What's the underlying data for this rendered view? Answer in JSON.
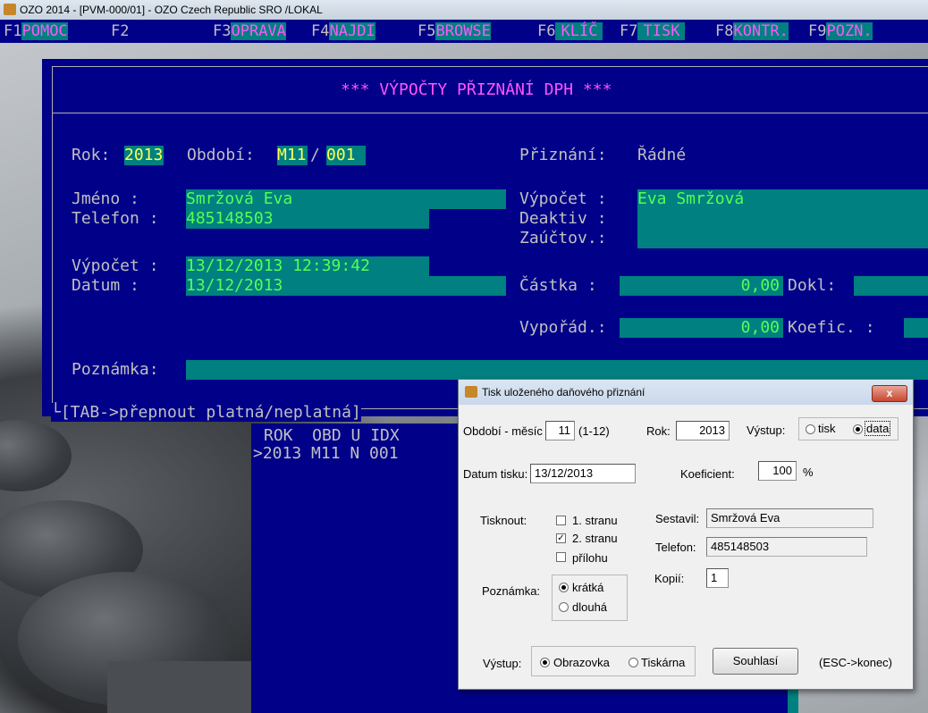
{
  "window": {
    "title": "OZO 2014 - [PVM-000/01] - OZO Czech Republic SRO  /LOKAL"
  },
  "menubar": [
    {
      "key": "F1",
      "label": "POMOC"
    },
    {
      "key": "F2",
      "label": ""
    },
    {
      "key": "F3",
      "label": "OPRAVA"
    },
    {
      "key": "F4",
      "label": "NAJDI"
    },
    {
      "key": "F5",
      "label": "BROWSE"
    },
    {
      "key": "F6",
      "label": "KLÍČ"
    },
    {
      "key": "F7",
      "label": "TISK"
    },
    {
      "key": "F8",
      "label": "KONTR."
    },
    {
      "key": "F9",
      "label": "POZN."
    }
  ],
  "main": {
    "heading": "*** VÝPOČTY PŘIZNÁNÍ DPH  ***",
    "rok_label": "Rok:",
    "rok": "2013",
    "obdobi_label": "Období:",
    "obdobi_m": "M11",
    "obdobi_sep": "/",
    "obdobi_n": "001",
    "priznani_label": "Přiznání:",
    "priznani": "Řádné",
    "jmeno_label": "Jméno   :",
    "jmeno": "Smržová Eva",
    "telefon_label": "Telefon :",
    "telefon": "485148503",
    "vypocet_label_r": "Výpočet :",
    "vypocet_r": "Eva Smržová",
    "deaktiv_label": "Deaktiv :",
    "zauctov_label": "Zaúčtov.:",
    "vypocet_label": "Výpočet :",
    "vypocet": "13/12/2013 12:39:42",
    "datum_label": "Datum   :",
    "datum": "13/12/2013",
    "castka_label": "Částka   :",
    "castka": "0,00",
    "dokl_label": "Dokl:",
    "vyporad_label": "Vypořád.:",
    "vyporad": "0,00",
    "koefic_label": "Koefic. :",
    "poznamka_label": "Poznámka:",
    "footer": "└[TAB->přepnout platná/neplatná]"
  },
  "list": {
    "headers": "ROK  OBD U IDX",
    "rows": [
      ">2013 M11 N 001"
    ]
  },
  "dialog": {
    "title": "Tisk uloženého daňového přiznání",
    "close": "x",
    "obdobi_label": "Období - měsíc",
    "obdobi": "11",
    "obdobi_range": "(1-12)",
    "rok_label": "Rok:",
    "rok": "2013",
    "vystup_label": "Výstup:",
    "vystup_opt1": "tisk",
    "vystup_opt2": "data",
    "datum_label": "Datum tisku:",
    "datum": "13/12/2013",
    "koef_label": "Koeficient:",
    "koef": "100",
    "koef_unit": "%",
    "tisknout_label": "Tisknout:",
    "check1": "1. stranu",
    "check2": "2. stranu",
    "check3": "přílohu",
    "sestavil_label": "Sestavil:",
    "sestavil": "Smržová Eva",
    "telefon_label": "Telefon:",
    "telefon": "485148503",
    "kopii_label": "Kopií:",
    "kopii": "1",
    "poznamka_label": "Poznámka:",
    "pozn_opt1": "krátká",
    "pozn_opt2": "dlouhá",
    "vystup2_label": "Výstup:",
    "vystup2_opt1": "Obrazovka",
    "vystup2_opt2": "Tiskárna",
    "souhlasi": "Souhlasí",
    "esc": "(ESC->konec)"
  },
  "colors": {
    "dos_blue": "#000088",
    "dos_cyan": "#008080",
    "field_green": "#55ff55",
    "menu_magenta": "#ff55ff"
  }
}
